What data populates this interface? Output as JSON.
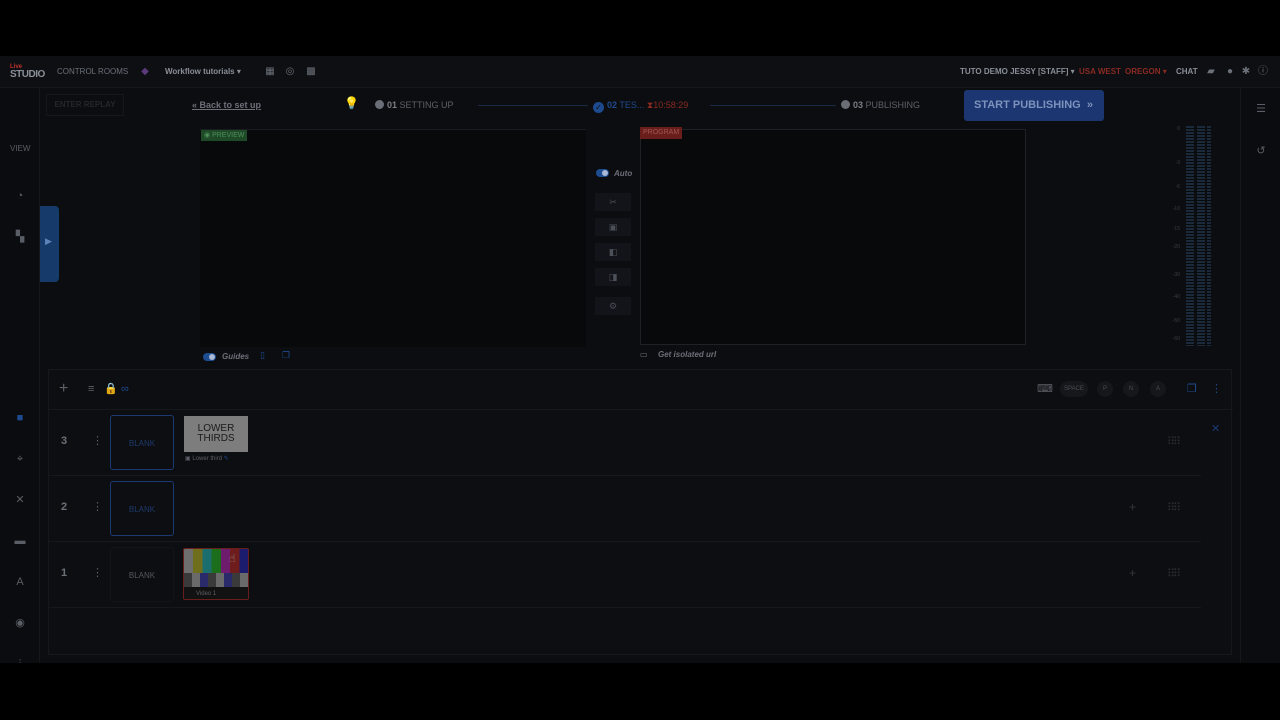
{
  "topbar": {
    "logo_top": "Live",
    "logo_bottom": "STUDIO",
    "control_rooms": "CONTROL ROOMS",
    "workflow": "Workflow tutorials",
    "user": "TUTO DEMO JESSY [STAFF]",
    "region": "USA WEST",
    "zone": "OREGON",
    "chat": "CHAT"
  },
  "leftrail": {
    "view_label": "VIEW"
  },
  "workflow": {
    "enter_replay": "ENTER REPLAY",
    "back_to_setup": "Back to set up",
    "step1_num": "01",
    "step1_label": "SETTING UP",
    "step2_num": "02",
    "step2_label": "TES...",
    "step2_timer": "10:58:29",
    "step3_num": "03",
    "step3_label": "PUBLISHING",
    "start_publishing": "START PUBLISHING"
  },
  "preview": {
    "tag": "PREVIEW",
    "guides": "Guides"
  },
  "program": {
    "tag": "PROGRAM",
    "auto": "Auto",
    "isolated_url": "Get isolated url"
  },
  "meter": {
    "labels": [
      "0",
      "-3",
      "-6",
      "-10",
      "-15",
      "-20",
      "-30",
      "-40",
      "-50",
      "-60"
    ]
  },
  "rundown": {
    "shortcut_space": "SPACE",
    "shortcut_p": "P",
    "shortcut_n": "N",
    "shortcut_a": "A",
    "layers": [
      {
        "num": "3",
        "blank": "BLANK",
        "thumb_title": "LOWER THIRDS",
        "thumb_caption": "Lower third"
      },
      {
        "num": "2",
        "blank": "BLANK"
      },
      {
        "num": "1",
        "blank": "BLANK",
        "thumb_caption": "Video 1"
      }
    ]
  }
}
